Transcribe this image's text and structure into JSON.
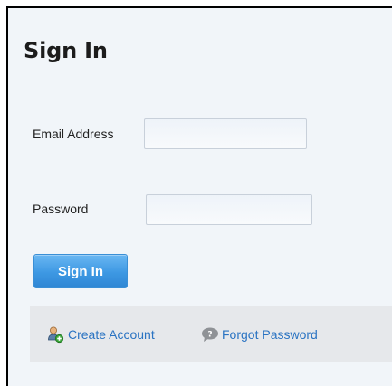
{
  "signin": {
    "title": "Sign In",
    "email_label": "Email Address",
    "email_value": "",
    "password_label": "Password",
    "password_value": "",
    "submit_label": "Sign In"
  },
  "footer": {
    "create_account": {
      "label": "Create Account",
      "icon": "user-add-icon"
    },
    "forgot_password": {
      "label": "Forgot Password",
      "icon": "help-bubble-icon"
    }
  },
  "colors": {
    "panel_bg": "#f1f5f9",
    "button": "#3d98e3",
    "link": "#2a73c2",
    "footer_bg": "#e6e8eb"
  }
}
